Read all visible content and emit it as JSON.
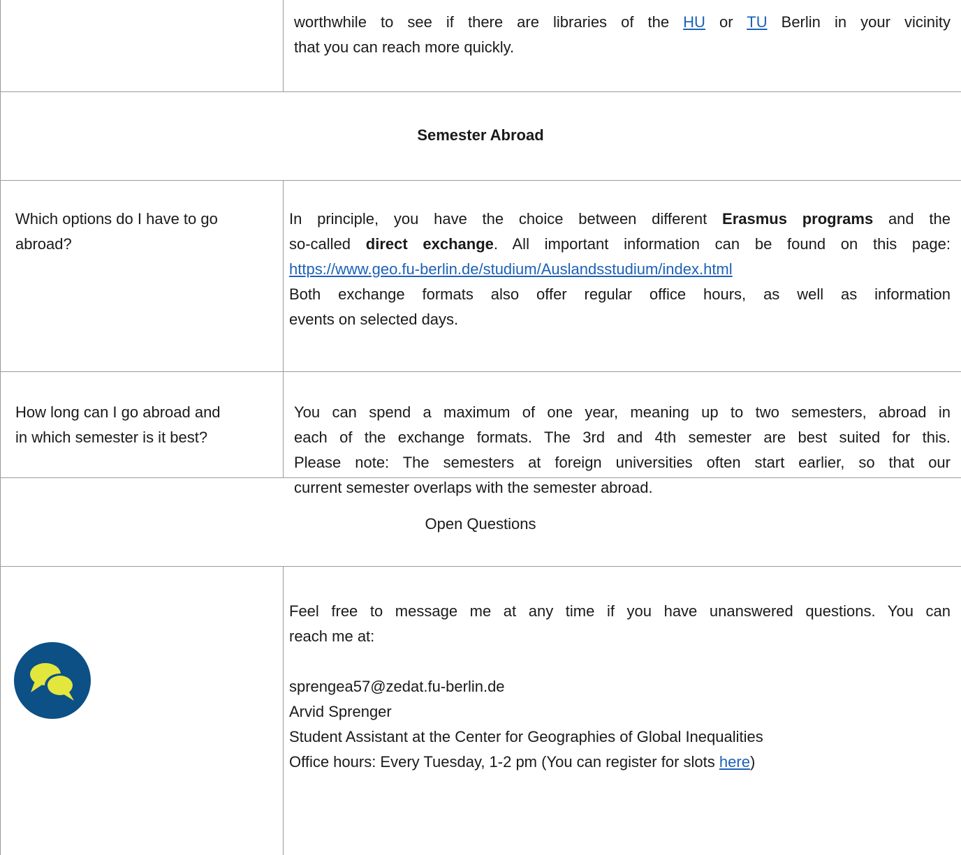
{
  "libraries": {
    "line1_prefix": "worthwhile to see if there are libraries of the",
    "hu_link": "HU",
    "or_text": "or",
    "tu_link": "TU",
    "line1_suffix": "Berlin in your vicinity",
    "line2": "that you can reach more quickly."
  },
  "section_abroad": {
    "title": "Semester Abroad"
  },
  "faq_options": {
    "question_line1": "Which options do I have to go",
    "question_line2": "abroad?",
    "a1_prefix": "In principle, you have the choice between different",
    "a1_bold": "Erasmus programs",
    "a1_suffix": "and the",
    "a2_prefix": "so-called",
    "a2_bold": "direct exchange",
    "a2_suffix": ". All important information can be found on this page:",
    "link": "https://www.geo.fu-berlin.de/studium/Auslandsstudium/index.html",
    "a4": "Both exchange formats also offer regular office hours, as well as information",
    "a5": "events on selected days."
  },
  "faq_duration": {
    "question_line1": "How long can I go abroad and",
    "question_line2": "in which semester is it best?",
    "a1": "You can spend a maximum of one year, meaning up to two semesters, abroad in",
    "a2": "each of the exchange formats. The 3rd and 4th semester are best suited for this.",
    "a3": "Please note: The semesters at foreign universities often start earlier, so that our",
    "a4": "current semester overlaps with the semester abroad."
  },
  "section_open": {
    "title": "Open Questions"
  },
  "contact": {
    "icon": "chat-bubbles-icon",
    "intro1": "Feel free to message me at any time if you have unanswered questions. You can",
    "intro2": "reach me at:",
    "email": "sprengea57@zedat.fu-berlin.de",
    "name": "Arvid Sprenger",
    "role": "Student Assistant at the Center for Geographies of Global Inequalities",
    "hours_prefix": "Office hours: Every Tuesday, 1-2 pm (You can register for slots",
    "hours_link": "here",
    "hours_suffix": ")"
  },
  "colors": {
    "icon_bg": "#0c5085",
    "icon_bubble": "#e3e63c",
    "link": "#1d61b8",
    "border": "#9a9a9a"
  }
}
